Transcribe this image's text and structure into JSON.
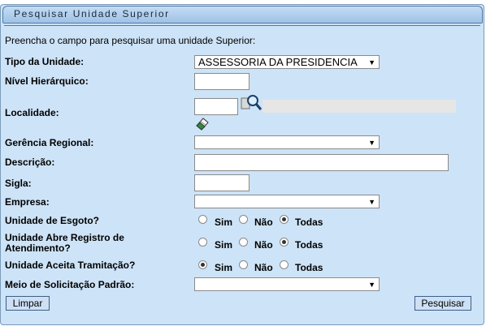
{
  "title": "Pesquisar Unidade Superior",
  "intro": "Preencha o campo para pesquisar uma unidade Superior:",
  "fields": {
    "tipo_unidade": {
      "label": "Tipo da Unidade:",
      "value": "ASSESSORIA DA PRESIDENCIA"
    },
    "nivel_hierarquico": {
      "label": "Nível Hierárquico:",
      "value": ""
    },
    "localidade": {
      "label": "Localidade:",
      "value": "",
      "description": ""
    },
    "gerencia_regional": {
      "label": "Gerência Regional:",
      "value": ""
    },
    "descricao": {
      "label": "Descrição:",
      "value": ""
    },
    "sigla": {
      "label": "Sigla:",
      "value": ""
    },
    "empresa": {
      "label": "Empresa:",
      "value": ""
    },
    "meio_solicitacao": {
      "label": "Meio de Solicitação Padrão:",
      "value": ""
    }
  },
  "radios": {
    "esgoto": {
      "label": "Unidade de Esgoto?",
      "selected": "Todas"
    },
    "registro": {
      "label_line1": "Unidade Abre Registro de",
      "label_line2": "Atendimento?",
      "selected": "Todas"
    },
    "tramitacao": {
      "label": "Unidade Aceita Tramitação?",
      "selected": "Sim"
    },
    "options": {
      "sim": "Sim",
      "nao": "Não",
      "todas": "Todas"
    }
  },
  "buttons": {
    "limpar": "Limpar",
    "pesquisar": "Pesquisar"
  },
  "icons": {
    "search": "magnifier-icon",
    "clear": "eraser-icon"
  },
  "colors": {
    "panel": "#cde3f7",
    "title_bar": "#9fc2e6",
    "button": "#cde0f5"
  }
}
